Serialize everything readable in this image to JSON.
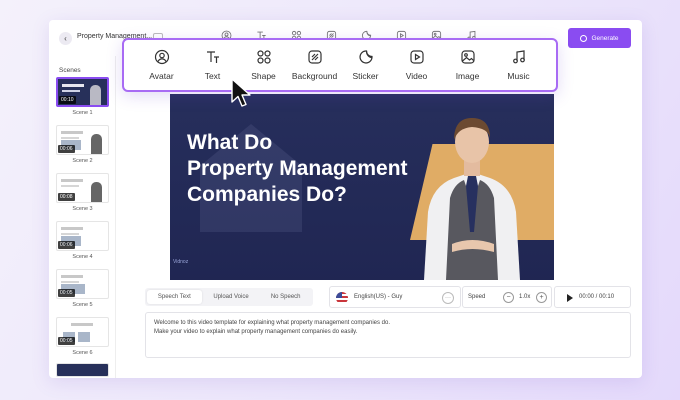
{
  "header": {
    "project_name": "Property Management...",
    "generate_label": "Generate",
    "mini_tools": [
      "avatar-icon",
      "text-icon",
      "shape-icon",
      "background-icon",
      "sticker-icon",
      "video-icon",
      "image-icon",
      "music-icon"
    ]
  },
  "toolbar": {
    "tools": [
      {
        "label": "Avatar",
        "icon": "avatar-icon"
      },
      {
        "label": "Text",
        "icon": "text-icon"
      },
      {
        "label": "Shape",
        "icon": "shape-icon"
      },
      {
        "label": "Background",
        "icon": "background-icon"
      },
      {
        "label": "Sticker",
        "icon": "sticker-icon"
      },
      {
        "label": "Video",
        "icon": "video-icon"
      },
      {
        "label": "Image",
        "icon": "image-icon"
      },
      {
        "label": "Music",
        "icon": "music-icon"
      }
    ]
  },
  "sidebar": {
    "title": "Scenes",
    "scenes": [
      {
        "label": "Scene 1",
        "duration": "00:10"
      },
      {
        "label": "Scene 2",
        "duration": "00:06"
      },
      {
        "label": "Scene 3",
        "duration": "00:08"
      },
      {
        "label": "Scene 4",
        "duration": "00:06"
      },
      {
        "label": "Scene 5",
        "duration": "00:05"
      },
      {
        "label": "Scene 6",
        "duration": "00:05"
      }
    ]
  },
  "preview": {
    "title_lines": [
      "What Do",
      "Property Management",
      "Companies Do?"
    ],
    "logo": "Vidnoz"
  },
  "speech": {
    "tabs": [
      "Speech Text",
      "Upload Voice",
      "No Speech"
    ],
    "voice": "English(US) - Guy",
    "speed_label": "Speed",
    "speed_value": "1.0x",
    "time": "00:00 / 00:10",
    "script_lines": [
      "Welcome to this video template for explaining what property management companies do.",
      "Make your video to explain what property management companies do easily."
    ]
  },
  "colors": {
    "accent": "#8a4cf1",
    "toolbar_border": "#a86bf4",
    "preview_bg": "#22295a",
    "gold": "#e0ac65"
  }
}
